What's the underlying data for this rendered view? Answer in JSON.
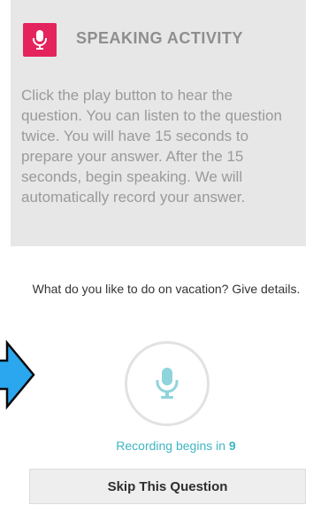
{
  "activity": {
    "title": "SPEAKING ACTIVITY",
    "icon": "microphone-icon",
    "badge_color": "#e4245c",
    "instructions": "Click the play button to hear the question. You can listen to the question twice. You will have 15 seconds to prepare your answer. After the 15 seconds, begin speaking. We will automatically record your answer."
  },
  "question": {
    "text": "What do you like to do on vacation? Give details."
  },
  "recorder": {
    "icon": "microphone-icon",
    "accent_color": "#3fb6c4",
    "status_prefix": "Recording begins in",
    "countdown": "9"
  },
  "actions": {
    "skip_label": "Skip This Question"
  },
  "overlay": {
    "icon": "right-arrow-icon",
    "color": "#2aa7ee"
  }
}
